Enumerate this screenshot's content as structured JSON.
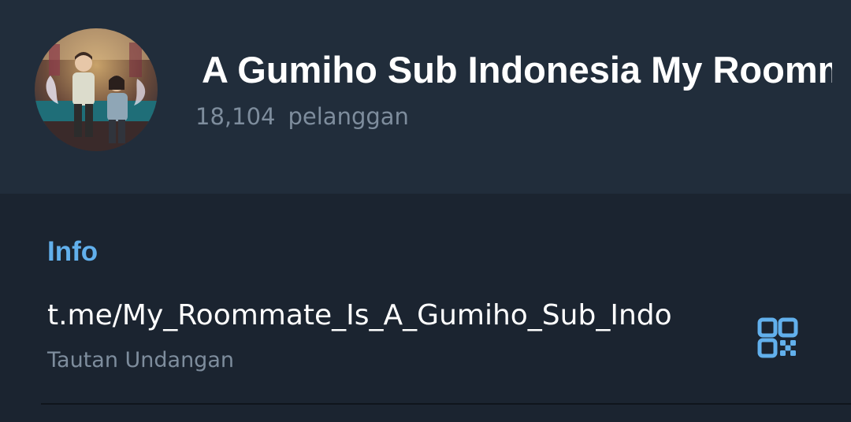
{
  "header": {
    "channel_title": "A Gumiho Sub Indonesia    My Roommate Is A Gumiho",
    "subscriber_count": "18,104",
    "subscriber_label": "pelanggan"
  },
  "info": {
    "section_title": "Info",
    "invite_link": "t.me/My_Roommate_Is_A_Gumiho_Sub_Indo",
    "invite_link_caption": "Tautan Undangan",
    "qr_icon": "qr-code-icon"
  },
  "colors": {
    "header_bg": "#212d3b",
    "page_bg": "#1b2430",
    "accent": "#62b0ec",
    "secondary_text": "#7e8d9d",
    "primary_text": "#ffffff"
  }
}
